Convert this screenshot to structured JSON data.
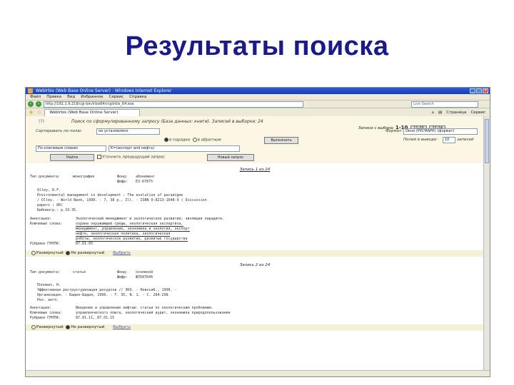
{
  "slide": {
    "title": "Результаты поиска"
  },
  "window": {
    "title": "WebIrbis (Web Base Online Server) - Windows Internet Explorer"
  },
  "menu": [
    "Файл",
    "Правка",
    "Вид",
    "Избранное",
    "Сервис",
    "Справка"
  ],
  "address": {
    "url": "http://192.1.9.218/cgi-bin/irbis64r/cgiirbis_64.exe",
    "search_placeholder": "Live Search"
  },
  "tab": {
    "label": "WebIrbis (Web Base Online Server)"
  },
  "tools": {
    "page": "Страница",
    "service": "Сервис"
  },
  "panel": {
    "help": "(?)",
    "query": "Поиск по сформулированному запросу (База данных: книги). Записей в выборке: 24",
    "range_label": "Записи с выбора:",
    "range_current": "1-10",
    "range_btn_2": "11-20",
    "range_btn_3": "21-24",
    "sort_label": "Сортировать по полю:",
    "sort_value": "не установлено",
    "format_label": "Формат:",
    "format_value": "Окно (РУСМАРК) (формат)",
    "doc_label": "Полей в выводе:",
    "doc_value": "10",
    "count_label": "записей",
    "radio_in_order": "в порядке",
    "radio_reverse": "в обратном",
    "apply_btn": "Выполнить",
    "field_value": "По ключевым словам",
    "query_value": "K=(экспорт and нефть)",
    "find_btn": "Найти",
    "refine_label": "Уточнить предыдущий запрос",
    "clear_btn": "Новый запрос"
  },
  "records": [
    {
      "header": "Запись 1 из 24",
      "type_label": "Тип документа:",
      "type_value": "монография",
      "fond_label": "Фонд:",
      "fond_value": "абонемент",
      "shifr_label": "Шифр:",
      "shifr_value": "Е3-67875",
      "lines": [
        "Olley, R.F.",
        "Environmental management in development : The evolution of paradigms",
        "/ Olley. - World Bank, 1990. - 7, 38 p., Ill. - ISBN 0-8213-1648-9 ( Discussion",
        "papers ; 80)",
        "Библиогр.: p.33-35."
      ],
      "annot_label": "Аннотация:",
      "annot_value": "Экологический менеджмент и экологическое развитие; эволюция парадигм.",
      "kw_label": "Ключевые слова:",
      "kw_lines": [
        "охрана окружающей среды, экологическая экспертиза,",
        "менеджмент, управление, экономика и экология, экспорт",
        "нефти, экологическая политика, экологическая",
        "роботы, экологическое развитие, развитые государства"
      ],
      "rub_label": "Рубрики ГРНТИ:",
      "rub_value": "87.01.05"
    },
    {
      "header": "Запись 2 из 24",
      "type_label": "Тип документа:",
      "type_value": "статья",
      "fond_label": "Фонд:",
      "fond_value": "основной",
      "shifr_label": "Шифр:",
      "shifr_value": "Ж3587646",
      "lines": [
        "Попович, Н.",
        "Эффективная реструктуризация ресурсов // ЭКО. - Новосиб., 1996. -",
        "Организация. - Баден-Баден, 1996. - Т. 35, N. 1. - С. 284-298",
        "Рез. англ."
      ],
      "annot_label": "Аннотация:",
      "annot_value": "Введение в управление нефтью: статьи по экологическим проблемам.",
      "kw_label": "Ключевые слова:",
      "kw_lines": [
        "управленческого опыта, экологический аудит, экономика природопользования"
      ],
      "rub_label": "Рубрики ГРНТИ:",
      "rub_value": "87.01.11, 87.01.15"
    }
  ],
  "fmt": {
    "radio_full": "Развернутый",
    "radio_short": "Не развернутый",
    "link": "Выбрать"
  }
}
